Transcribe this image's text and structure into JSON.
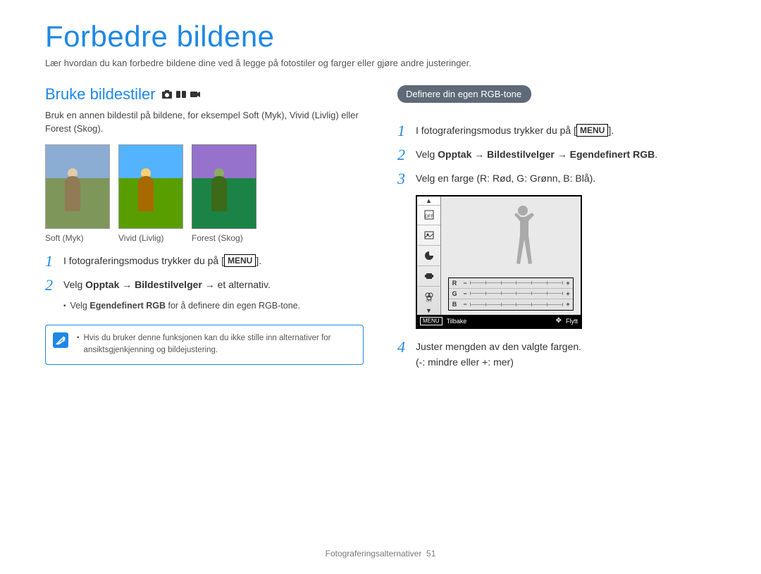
{
  "title": "Forbedre bildene",
  "intro": "Lær hvordan du kan forbedre bildene dine ved å legge på fotostiler og farger eller gjøre andre justeringer.",
  "left": {
    "heading": "Bruke bildestiler",
    "desc": "Bruk en annen bildestil på bildene, for eksempel Soft (Myk), Vivid (Livlig) eller Forest (Skog).",
    "thumbs": [
      {
        "label": "Soft (Myk)"
      },
      {
        "label": "Vivid (Livlig)"
      },
      {
        "label": "Forest (Skog)"
      }
    ],
    "step1_pre": "I fotograferingsmodus trykker du på [",
    "step1_post": "].",
    "menu_badge": "MENU",
    "step2_pre": "Velg ",
    "step2_bold": "Opptak → Bildestilvelger",
    "step2_post": " → et alternativ.",
    "sub_pre": "Velg ",
    "sub_bold": "Egendefinert RGB",
    "sub_post": " for å definere din egen RGB-tone.",
    "tip": "Hvis du bruker denne funksjonen kan du ikke stille inn alternativer for ansiktsgjenkjenning og bildejustering."
  },
  "right": {
    "pill": "Definere din egen RGB-tone",
    "step1_pre": "I fotograferingsmodus trykker du på [",
    "step1_post": "].",
    "menu_badge": "MENU",
    "step2_pre": "Velg ",
    "step2_bold": "Opptak → Bildestilvelger → Egendefinert RGB",
    "step2_post": ".",
    "step3": "Velg en farge (R: Rød, G: Grønn, B: Blå).",
    "screenshot": {
      "rows": [
        "R",
        "G",
        "B"
      ],
      "bottom_menu": "MENU",
      "bottom_back": "Tilbake",
      "bottom_move": "Flytt"
    },
    "step4": "Juster mengden av den valgte fargen.",
    "step4_note": "(-: mindre eller +: mer)"
  },
  "footer": {
    "label": "Fotograferingsalternativer",
    "page": "51"
  }
}
